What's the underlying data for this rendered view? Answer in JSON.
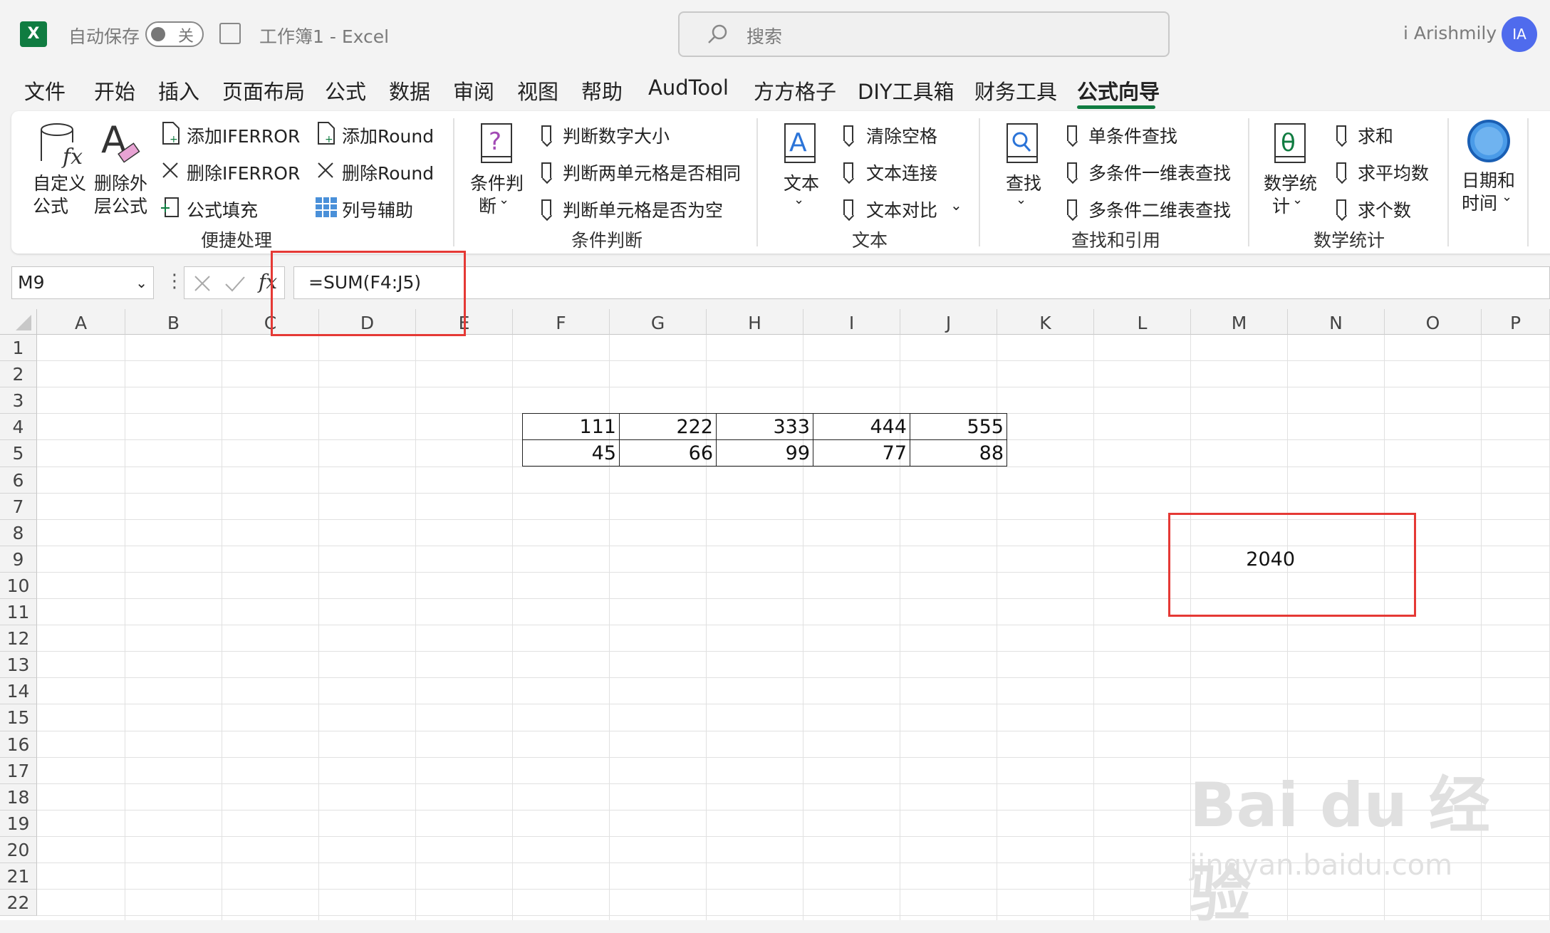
{
  "titlebar": {
    "logo_letter": "X",
    "autosave_label": "自动保存",
    "autosave_state": "关",
    "doc_title": "工作簿1  -  Excel",
    "search_placeholder": "搜索",
    "user_name": "i Arishmily",
    "user_initials": "IA"
  },
  "menu": {
    "items": [
      "文件",
      "开始",
      "插入",
      "页面布局",
      "公式",
      "数据",
      "审阅",
      "视图",
      "帮助",
      "AudTool",
      "方方格子",
      "DIY工具箱",
      "财务工具",
      "公式向导"
    ],
    "active": "公式向导"
  },
  "ribbon": {
    "g1": {
      "custom_formula_1": "自定义",
      "custom_formula_2": "公式",
      "remove_outer_1": "删除外",
      "remove_outer_2": "层公式",
      "add_iferror": "添加IFERROR",
      "remove_iferror": "删除IFERROR",
      "formula_fill": "公式填充",
      "add_round": "添加Round",
      "remove_round": "删除Round",
      "col_helper": "列号辅助",
      "group_label": "便捷处理"
    },
    "g2": {
      "cond_1": "条件判",
      "cond_2": "断",
      "judge_num": "判断数字大小",
      "judge_same": "判断两单元格是否相同",
      "judge_empty": "判断单元格是否为空",
      "group_label": "条件判断"
    },
    "g3": {
      "text_btn": "文本",
      "clear_space": "清除空格",
      "text_join": "文本连接",
      "text_compare": "文本对比",
      "group_label": "文本"
    },
    "g4": {
      "find_btn": "查找",
      "single_find": "单条件查找",
      "multi_1d": "多条件一维表查找",
      "multi_2d": "多条件二维表查找",
      "group_label": "查找和引用"
    },
    "g5": {
      "math_1": "数学统",
      "math_2": "计",
      "sum": "求和",
      "avg": "求平均数",
      "count": "求个数",
      "group_label": "数学统计"
    },
    "g6": {
      "date_1": "日期和",
      "date_2": "时间"
    }
  },
  "formula_bar": {
    "name_box": "M9",
    "fx_label": "fx",
    "formula": "=SUM(F4:J5)"
  },
  "sheet": {
    "columns": [
      "A",
      "B",
      "C",
      "D",
      "E",
      "F",
      "G",
      "H",
      "I",
      "J",
      "K",
      "L",
      "M",
      "N",
      "O",
      "P"
    ],
    "rows": [
      "1",
      "2",
      "3",
      "4",
      "5",
      "6",
      "7",
      "8",
      "9",
      "10",
      "11",
      "12",
      "13",
      "14",
      "15",
      "16",
      "17",
      "18",
      "19",
      "20",
      "21",
      "22"
    ],
    "row4": [
      "111",
      "222",
      "333",
      "444",
      "555"
    ],
    "row5": [
      "45",
      "66",
      "99",
      "77",
      "88"
    ],
    "m9": "2040"
  },
  "watermark": {
    "brand": "Bai du 经验",
    "url": "jingyan.baidu.com"
  }
}
